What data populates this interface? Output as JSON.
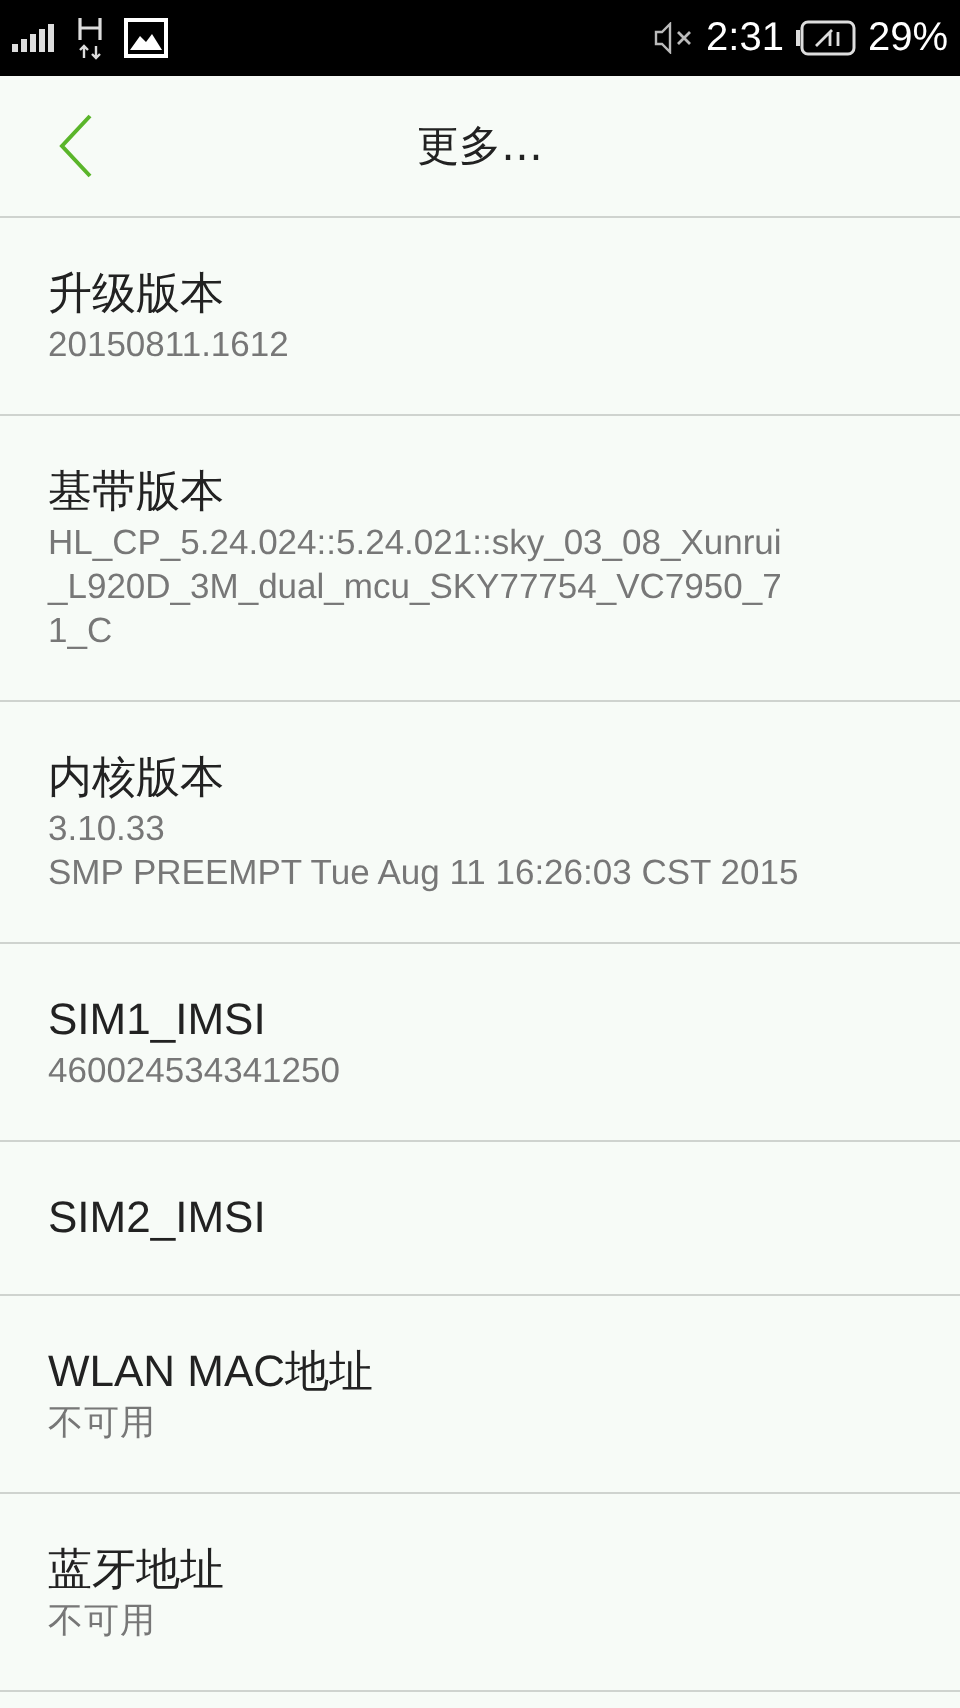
{
  "status_bar": {
    "time": "2:31",
    "battery": "29%"
  },
  "header": {
    "title": "更多…"
  },
  "items": [
    {
      "title": "升级版本",
      "lines": [
        "20150811.1612"
      ]
    },
    {
      "title": "基带版本",
      "lines": [
        "HL_CP_5.24.024::5.24.021::sky_03_08_Xunrui",
        "_L920D_3M_dual_mcu_SKY77754_VC7950_7",
        "1_C"
      ]
    },
    {
      "title": "内核版本",
      "lines": [
        "3.10.33",
        "SMP PREEMPT Tue Aug 11 16:26:03 CST 2015"
      ]
    },
    {
      "title": "SIM1_IMSI",
      "lines": [
        "460024534341250"
      ]
    },
    {
      "title": "SIM2_IMSI"
    },
    {
      "title": "WLAN MAC地址",
      "lines": [
        "不可用"
      ]
    },
    {
      "title": "蓝牙地址",
      "lines": [
        "不可用"
      ]
    }
  ]
}
